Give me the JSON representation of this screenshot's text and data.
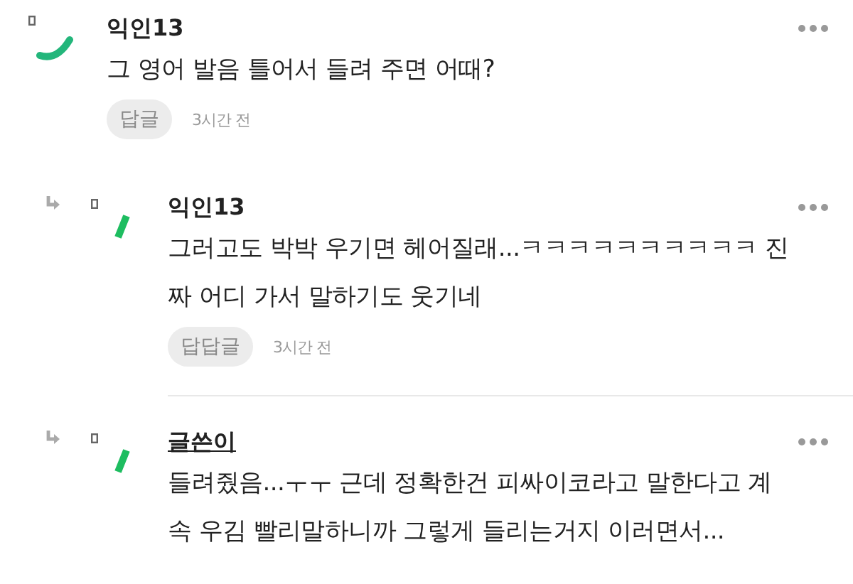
{
  "comments": [
    {
      "kind": "comment",
      "author": "익인13",
      "is_writer": false,
      "lines": [
        "그 영어 발음 틀어서 들려 주면 어때?"
      ],
      "reply_label": "답글",
      "time": "3시간 전"
    },
    {
      "kind": "reply",
      "author": "익인13",
      "is_writer": false,
      "lines": [
        "그러고도 박박 우기면 헤어질래...ㅋㅋㅋㅋㅋㅋㅋㅋㅋㅋ 진",
        "짜 어디 가서 말하기도 웃기네"
      ],
      "reply_label": "답답글",
      "time": "3시간 전"
    },
    {
      "kind": "reply",
      "author": "글쓴이",
      "is_writer": true,
      "lines": [
        "들려줬음...ㅜㅜ 근데 정확한건 피싸이코라고 말한다고 계",
        "속 우김 빨리말하니까 그렇게 들리는거지 이러면서..."
      ]
    }
  ]
}
